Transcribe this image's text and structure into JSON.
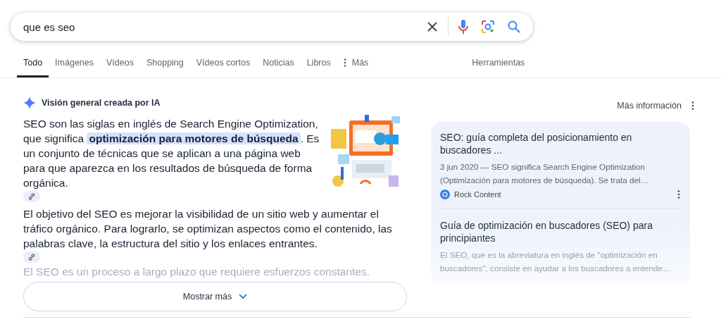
{
  "search": {
    "query": "que es seo"
  },
  "tabs": [
    {
      "label": "Todo",
      "selected": true,
      "kind": "tab"
    },
    {
      "label": "Imágenes",
      "selected": false,
      "kind": "tab"
    },
    {
      "label": "Vídeos",
      "selected": false,
      "kind": "tab"
    },
    {
      "label": "Shopping",
      "selected": false,
      "kind": "tab"
    },
    {
      "label": "Vídeos cortos",
      "selected": false,
      "kind": "tab"
    },
    {
      "label": "Noticias",
      "selected": false,
      "kind": "tab"
    },
    {
      "label": "Libros",
      "selected": false,
      "kind": "tab"
    },
    {
      "label": "Más",
      "selected": false,
      "kind": "menu"
    }
  ],
  "tools": "Herramientas",
  "ai_overview": {
    "title": "Visión general creada por IA",
    "more_info": "Más información",
    "paragraphs": [
      {
        "text": "SEO son las siglas en inglés de Search Engine Optimization, que significa **optimización para motores de búsqueda**. Es un conjunto de técnicas que se aplican a una página web para que aparezca en los resultados de búsqueda de forma orgánica."
      },
      {
        "text": "El objetivo del SEO es mejorar la visibilidad de un sitio web y aumentar el tráfico orgánico. Para lograrlo, se optimizan aspectos como el contenido, las palabras clave, la estructura del sitio y los enlaces entrantes."
      },
      {
        "text": "El SEO es un proceso a largo plazo que requiere esfuerzos constantes."
      }
    ],
    "show_more": "Mostrar más"
  },
  "sources": [
    {
      "title": "SEO: guía completa del posicionamiento en buscadores ...",
      "snippet": "3 jun 2020 — SEO significa Search Engine Optimization (Optimización para motores de búsqueda). Se trata del…",
      "site": "Rock Content"
    },
    {
      "title": "Guía de optimización en buscadores (SEO) para principiantes",
      "snippet": "El SEO, que es la abreviatura en inglés de \"optimización en buscadores\", consiste en ayudar a los buscadores a entende…"
    }
  ]
}
